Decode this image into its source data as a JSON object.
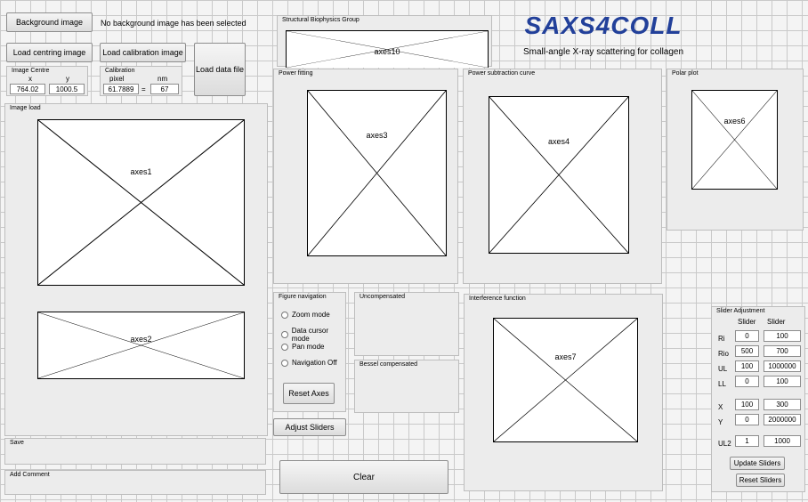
{
  "buttons": {
    "background_image": "Background image",
    "load_centring_image": "Load centring image",
    "load_calibration_image": "Load calibration image",
    "load_data_file": "Load data file",
    "reset_axes": "Reset Axes",
    "adjust_sliders": "Adjust Sliders",
    "clear": "Clear",
    "update_sliders": "Update Sliders",
    "reset_sliders": "Reset Sliders"
  },
  "status": {
    "background": "No background image has been selected"
  },
  "image_centre": {
    "title": "Image Centre",
    "x_label": "x",
    "y_label": "y",
    "x_value": "764.02",
    "y_value": "1000.5"
  },
  "calibration": {
    "title": "Calibration",
    "pixel_label": "pixel",
    "nm_label": "nm",
    "pixel_value": "61.7889",
    "equals": "=",
    "nm_value": "67"
  },
  "header": {
    "group": "Structural Biophysics Group",
    "logo": "SAXS4COLL",
    "subtitle": "Small-angle X-ray scattering for collagen"
  },
  "panels": {
    "image_load": "Image load",
    "power_fitting": "Power fitting",
    "power_subtraction": "Power subtraction curve",
    "polar_plot": "Polar plot",
    "figure_navigation": "Figure navigation",
    "uncompensated": "Uncompensated",
    "bessel_compensated": "Bessel compensated",
    "interference_function": "Interference function",
    "save": "Save",
    "add_comment": "Add Comment",
    "slider_adjustment": "Slider Adjustment"
  },
  "axes": {
    "axes1": "axes1",
    "axes2": "axes2",
    "axes3": "axes3",
    "axes4": "axes4",
    "axes6": "axes6",
    "axes7": "axes7",
    "axes10": "axes10"
  },
  "navigation": {
    "zoom": "Zoom mode",
    "data_cursor": "Data cursor mode",
    "pan": "Pan mode",
    "off": "Navigation Off"
  },
  "sliders": {
    "col1": "Slider",
    "col2": "Slider",
    "rows": [
      {
        "label": "Ri",
        "v1": "0",
        "v2": "100"
      },
      {
        "label": "Rio",
        "v1": "500",
        "v2": "700"
      },
      {
        "label": "UL",
        "v1": "100",
        "v2": "1000000"
      },
      {
        "label": "LL",
        "v1": "0",
        "v2": "100"
      },
      {
        "label": "X",
        "v1": "100",
        "v2": "300"
      },
      {
        "label": "Y",
        "v1": "0",
        "v2": "2000000"
      },
      {
        "label": "UL2",
        "v1": "1",
        "v2": "1000"
      }
    ]
  }
}
